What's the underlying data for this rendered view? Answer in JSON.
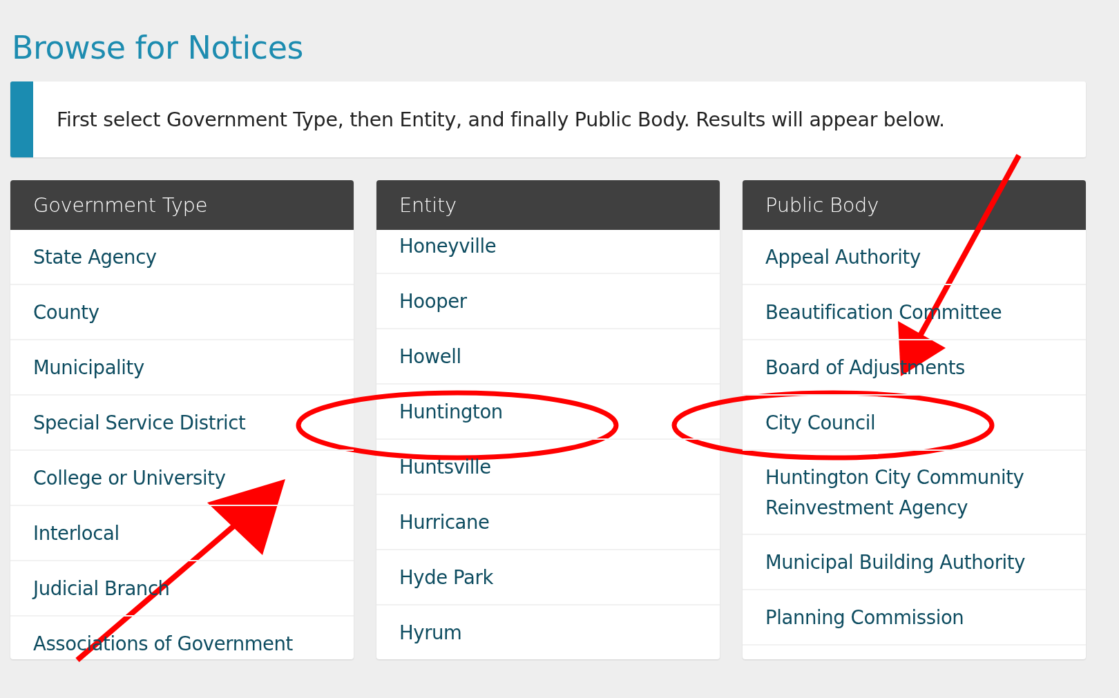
{
  "title": "Browse for Notices",
  "notice": "First select Government Type, then Entity, and finally Public Body. Results will appear below.",
  "columns": [
    {
      "heading": "Government Type",
      "scrolled": false,
      "items": [
        "State Agency",
        "County",
        "Municipality",
        "Special Service District",
        "College or University",
        "Interlocal",
        "Judicial Branch",
        "Associations of Government"
      ]
    },
    {
      "heading": "Entity",
      "scrolled": true,
      "items": [
        "Honeyville",
        "Hooper",
        "Howell",
        "Huntington",
        "Huntsville",
        "Hurricane",
        "Hyde Park",
        "Hyrum"
      ]
    },
    {
      "heading": "Public Body",
      "scrolled": false,
      "items": [
        "Appeal Authority",
        "Beautification Committee",
        "Board of Adjustments",
        "City Council",
        "Huntington City Community Reinvestment Agency",
        "Municipal Building Authority",
        "Planning Commission"
      ]
    }
  ]
}
